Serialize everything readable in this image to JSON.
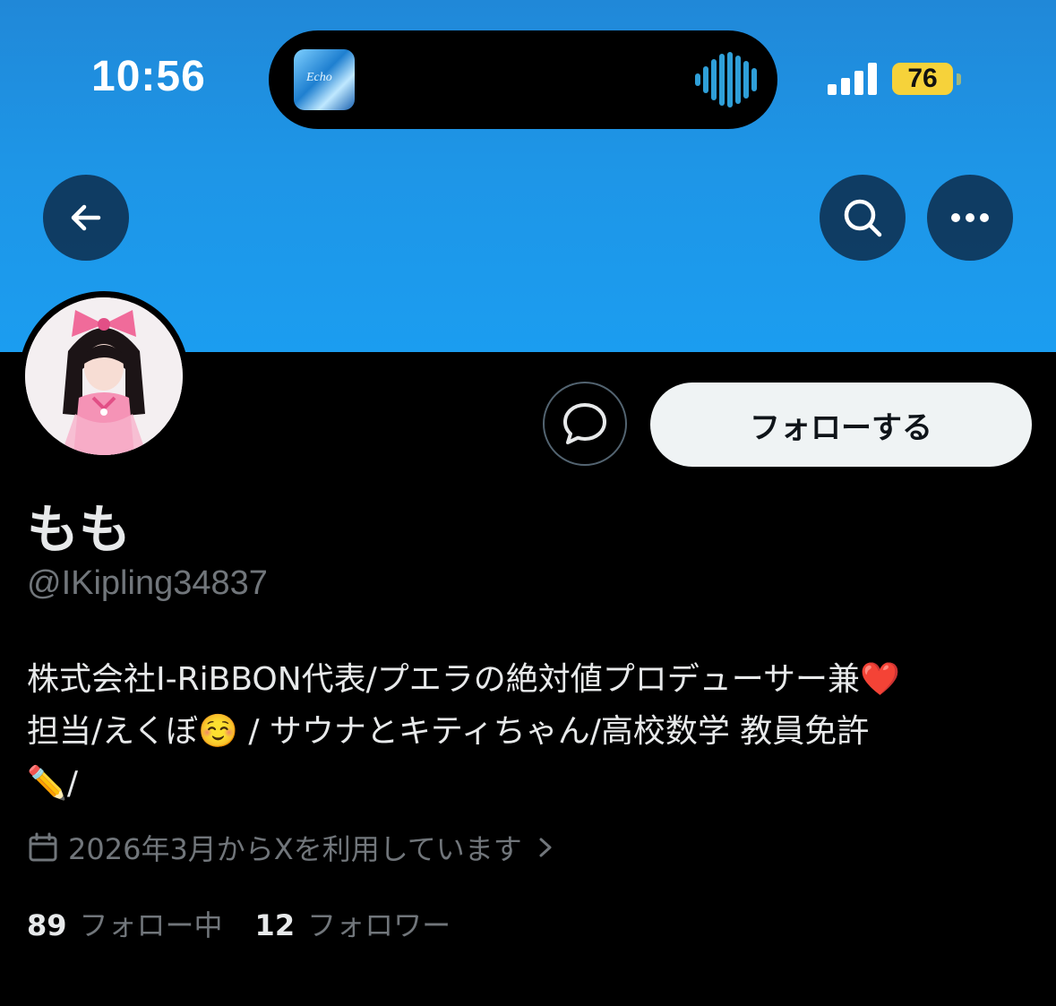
{
  "status_bar": {
    "time": "10:56",
    "battery": "76",
    "now_playing_art_text": "Echo"
  },
  "nav": {
    "back_icon": "arrow-left-icon",
    "search_icon": "search-icon",
    "more_icon": "more-horizontal-icon"
  },
  "profile": {
    "display_name": "もも",
    "handle": "@IKipling34837",
    "follow_label": "フォローする",
    "bio_line1": "株式会社I-RiBBON代表/プエラの絶対値プロデューサー兼❤️",
    "bio_line2": "担当/えくぼ☺️ / サウナとキティちゃん/高校数学 教員免許",
    "bio_line3": "✏️/",
    "joined": "2026年3月からXを利用しています",
    "following_count": "89",
    "following_label": "フォロー中",
    "followers_count": "12",
    "followers_label": "フォロワー"
  },
  "colors": {
    "banner": "#1d9bf0",
    "background": "#000000",
    "secondary_text": "#71767b",
    "battery": "#f6d23a"
  }
}
